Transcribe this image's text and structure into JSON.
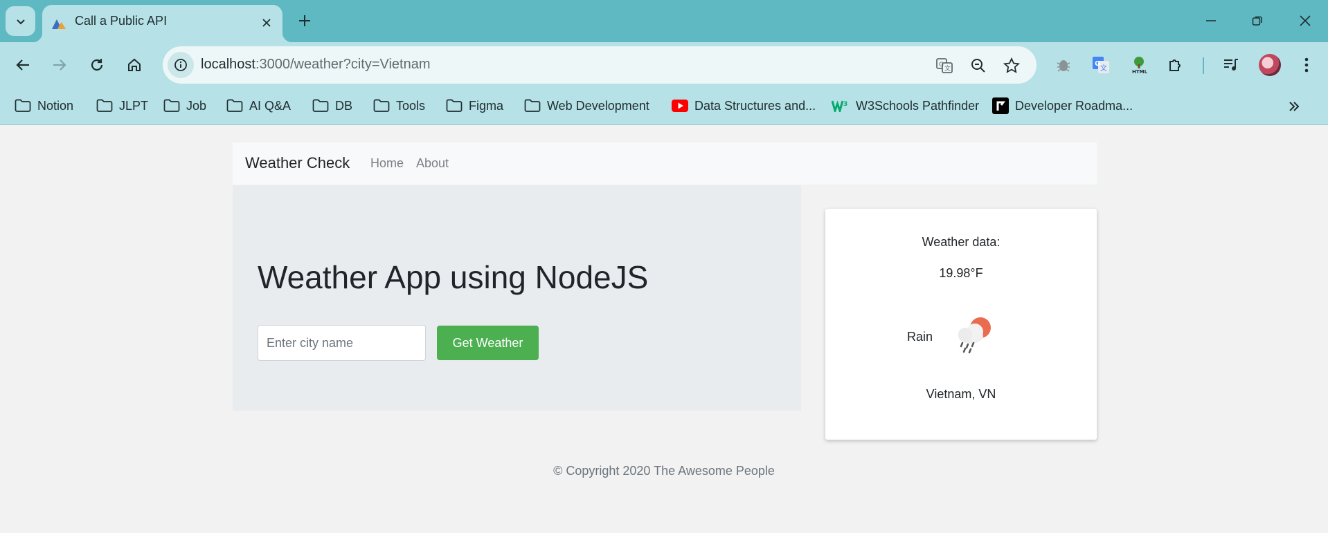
{
  "browser": {
    "tab_title": "Call a Public API",
    "url_host": "localhost",
    "url_rest": ":3000/weather?city=Vietnam",
    "bookmarks": [
      {
        "label": "Notion",
        "icon": "folder-icon"
      },
      {
        "label": "JLPT",
        "icon": "folder-icon"
      },
      {
        "label": "Job",
        "icon": "folder-icon"
      },
      {
        "label": "AI Q&A",
        "icon": "folder-icon"
      },
      {
        "label": "DB",
        "icon": "folder-icon"
      },
      {
        "label": "Tools",
        "icon": "folder-icon"
      },
      {
        "label": "Figma",
        "icon": "folder-icon"
      },
      {
        "label": "Web Development",
        "icon": "folder-icon"
      },
      {
        "label": "Data Structures and...",
        "icon": "youtube-icon"
      },
      {
        "label": "W3Schools Pathfinder",
        "icon": "w3schools-icon"
      },
      {
        "label": "Developer Roadma...",
        "icon": "roadmap-icon"
      }
    ],
    "colors": {
      "frame": "#5eb9c2",
      "toolbar": "#b6e1e6"
    }
  },
  "site": {
    "brand": "Weather Check",
    "nav": [
      "Home",
      "About"
    ],
    "hero_title": "Weather App using NodeJS",
    "city_placeholder": "Enter city name",
    "submit_label": "Get Weather",
    "button_color": "#4caf50"
  },
  "weather": {
    "heading": "Weather data:",
    "temperature": "19.98°F",
    "condition": "Rain",
    "condition_icon": "rain-cloud-sun-icon",
    "location": "Vietnam, VN"
  },
  "footer": {
    "text": "© Copyright 2020 The Awesome People"
  }
}
